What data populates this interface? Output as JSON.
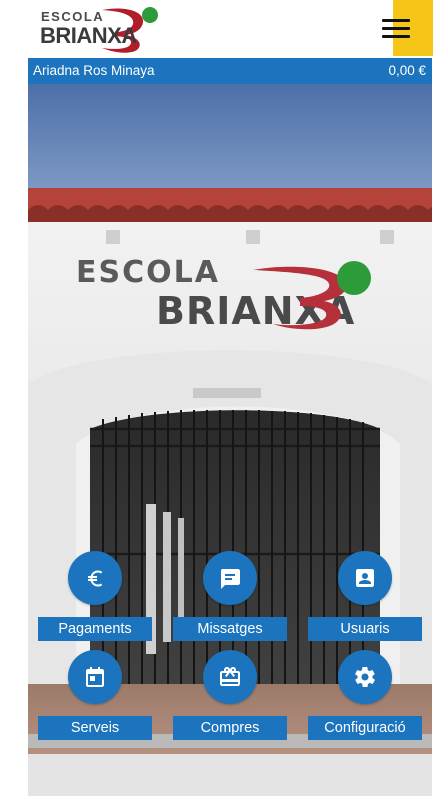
{
  "header": {
    "logo_line1": "ESCOLA",
    "logo_line2": "BRIANXA",
    "menu_icon": "hamburger-menu-icon"
  },
  "user": {
    "name": "Ariadna Ros Minaya",
    "balance": "0,00 €"
  },
  "banner": {
    "sign_line1": "ESCOLA",
    "sign_line2": "BRIANXA"
  },
  "actions": [
    {
      "label": "Pagaments",
      "icon": "euro-icon"
    },
    {
      "label": "Missatges",
      "icon": "message-icon"
    },
    {
      "label": "Usuaris",
      "icon": "user-card-icon"
    },
    {
      "label": "Serveis",
      "icon": "calendar-icon"
    },
    {
      "label": "Compres",
      "icon": "gift-card-icon"
    },
    {
      "label": "Configuració",
      "icon": "gear-icon"
    }
  ],
  "colors": {
    "primary_blue": "#1b74bd",
    "menu_yellow": "#f5c518",
    "logo_red": "#b01e2c",
    "logo_green": "#2e9b3a"
  }
}
